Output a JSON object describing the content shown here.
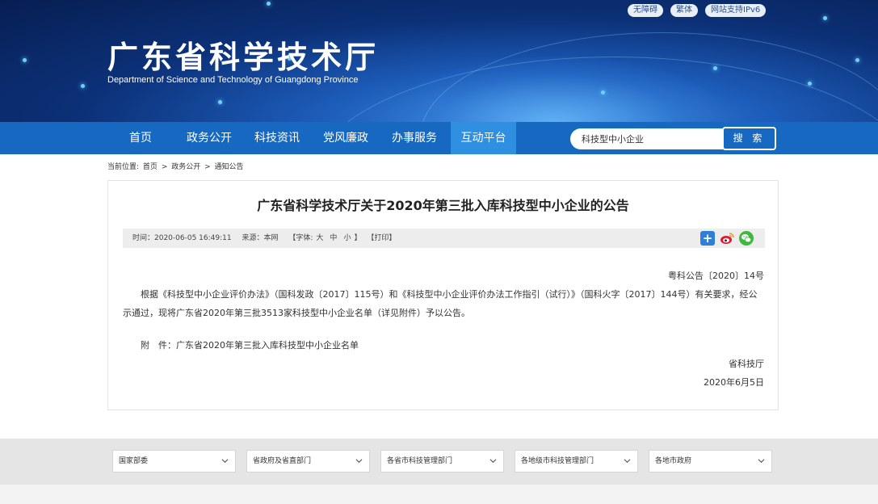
{
  "header": {
    "title": "广东省科学技术厅",
    "subtitle": "Department of Science and Technology of Guangdong Province",
    "top_links": [
      "无障碍",
      "繁体",
      "网站支持IPv6"
    ]
  },
  "nav": {
    "items": [
      "首页",
      "政务公开",
      "科技资讯",
      "党风廉政",
      "办事服务",
      "互动平台"
    ],
    "active": "互动平台"
  },
  "search": {
    "value": "科技型中小企业",
    "button_label": "搜 索"
  },
  "breadcrumb": {
    "prefix": "当前位置:",
    "items": [
      "首页",
      "政务公开",
      "通知公告"
    ],
    "separator": ">"
  },
  "article": {
    "title": "广东省科学技术厅关于2020年第三批入库科技型中小企业的公告",
    "meta": {
      "time": "时间：2020-06-05 16:49:11",
      "source": "来源：本网",
      "font_label": "【字体:",
      "font_large": "大",
      "font_medium": "中",
      "font_small": "小",
      "font_close": "】",
      "print": "【打印】"
    },
    "doc_number": "粤科公告〔2020〕14号",
    "body": "根据《科技型中小企业评价办法》（国科发政〔2017〕115号）和《科技型中小企业评价办法工作指引（试行）》（国科火字〔2017〕144号）有关要求，经公示通过，现将广东省2020年第三批3513家科技型中小企业名单（详见附件）予以公告。",
    "attachment": "附　件：广东省2020年第三批入库科技型中小企业名单",
    "signature": "省科技厅",
    "date": "2020年6月5日"
  },
  "footer": {
    "selects": [
      "国家部委",
      "省政府及省直部门",
      "各省市科技管理部门",
      "各地级市科技管理部门",
      "各地市政府"
    ]
  },
  "colors": {
    "nav_bg": "#1668c1",
    "nav_active": "#2f8fe0",
    "footer_bg": "#e5e5e5"
  }
}
